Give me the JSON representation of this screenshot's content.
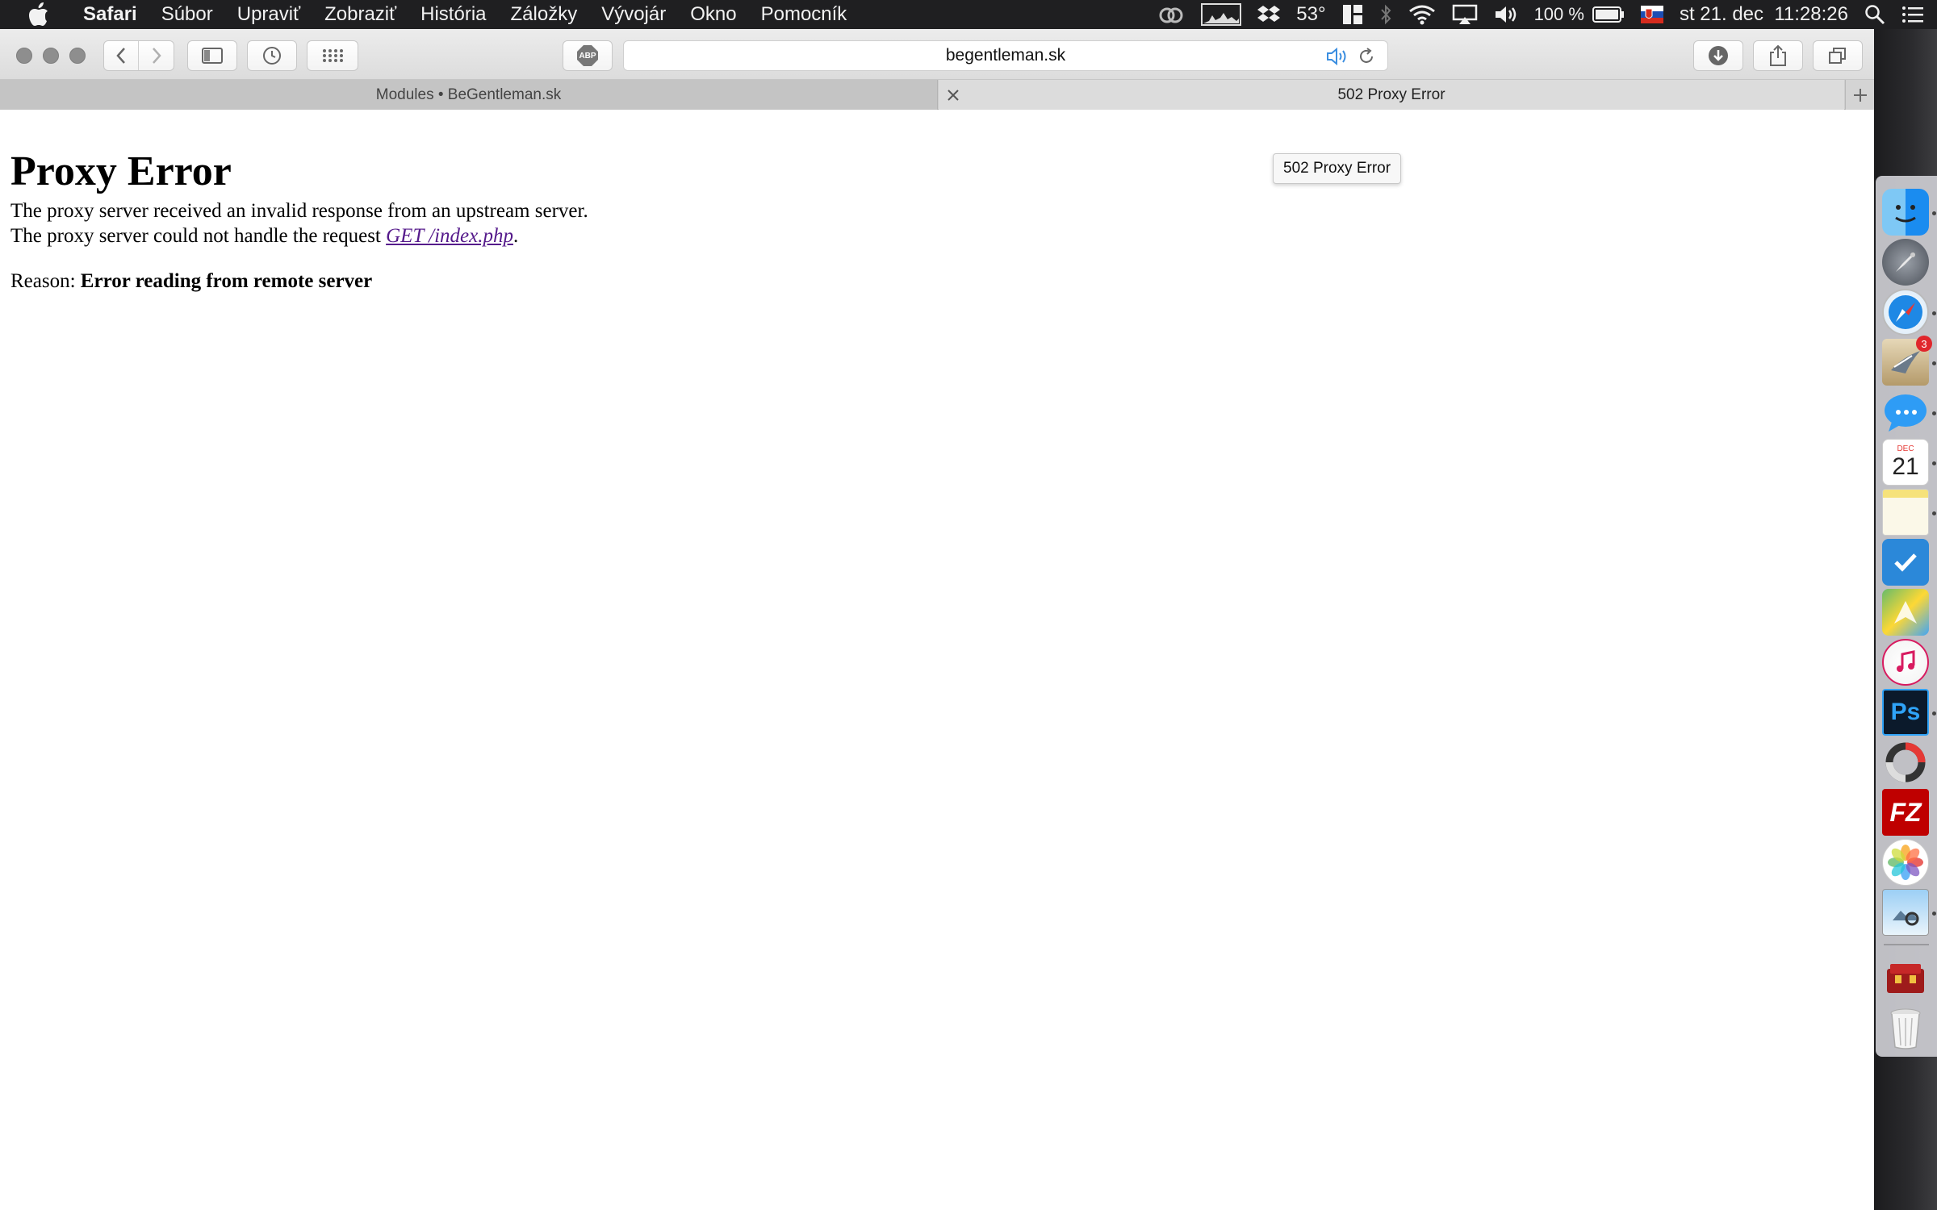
{
  "menubar": {
    "app_name": "Safari",
    "items": [
      "Súbor",
      "Upraviť",
      "Zobraziť",
      "História",
      "Záložky",
      "Vývojár",
      "Okno",
      "Pomocník"
    ],
    "status": {
      "temperature": "53°",
      "battery_percent": "100 %",
      "datetime": "st 21. dec  11:28:26"
    }
  },
  "toolbar": {
    "address": "begentleman.sk",
    "adblock_label": "ABP"
  },
  "tabs": [
    {
      "title": "Modules • BeGentleman.sk",
      "active": false
    },
    {
      "title": "502 Proxy Error",
      "active": true
    }
  ],
  "tooltip": "502 Proxy Error",
  "page": {
    "heading": "Proxy Error",
    "line1": "The proxy server received an invalid response from an upstream server.",
    "line2_prefix": "The proxy server could not handle the request ",
    "line2_link": "GET /index.php",
    "line2_suffix": ".",
    "reason_label": "Reason: ",
    "reason_value": "Error reading from remote server"
  },
  "dock": {
    "apps": [
      {
        "icon": "finder-icon"
      },
      {
        "icon": "launchpad-icon"
      },
      {
        "icon": "safari-icon"
      },
      {
        "icon": "mail-icon",
        "badge": "3"
      },
      {
        "icon": "messages-icon"
      },
      {
        "icon": "calendar-icon",
        "month": "DEC",
        "day": "21"
      },
      {
        "icon": "notes-icon"
      },
      {
        "icon": "wunderlist-icon"
      },
      {
        "icon": "maps-icon"
      },
      {
        "icon": "itunes-icon"
      },
      {
        "icon": "photoshop-icon",
        "label": "Ps"
      },
      {
        "icon": "activity-icon"
      },
      {
        "icon": "filezilla-icon",
        "label": "FZ"
      },
      {
        "icon": "photos-icon"
      },
      {
        "icon": "preview-icon"
      },
      {
        "icon": "downloads-stack-icon"
      },
      {
        "icon": "trash-icon"
      }
    ],
    "colors": {
      "accent": "#1a8cf0",
      "photoshop": "#0b1a2b",
      "filezilla": "#bf0000",
      "badge": "#e0262c"
    }
  }
}
